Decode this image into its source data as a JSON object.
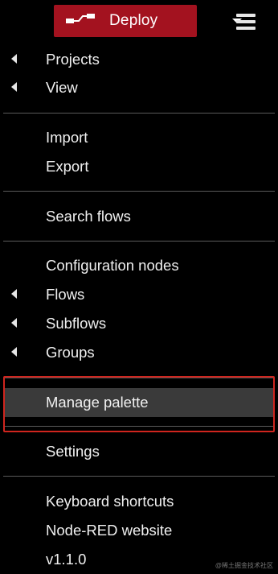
{
  "header": {
    "deploy_label": "Deploy"
  },
  "menu": {
    "projects": "Projects",
    "view": "View",
    "import": "Import",
    "export": "Export",
    "search_flows": "Search flows",
    "configuration_nodes": "Configuration nodes",
    "flows": "Flows",
    "subflows": "Subflows",
    "groups": "Groups",
    "manage_palette": "Manage palette",
    "settings": "Settings",
    "keyboard_shortcuts": "Keyboard shortcuts",
    "node_red_website": "Node-RED website",
    "version": "v1.1.0"
  },
  "watermark": "@稀土掘金技术社区",
  "colors": {
    "deploy_red": "#a3121f",
    "highlight_border": "#d0251e",
    "background": "#000000",
    "text": "#f0f0f0"
  },
  "icons": {
    "deploy": "deploy-icon",
    "deploy_dropdown": "caret-down-icon",
    "menu": "hamburger-icon",
    "submenu": "caret-left-icon"
  }
}
